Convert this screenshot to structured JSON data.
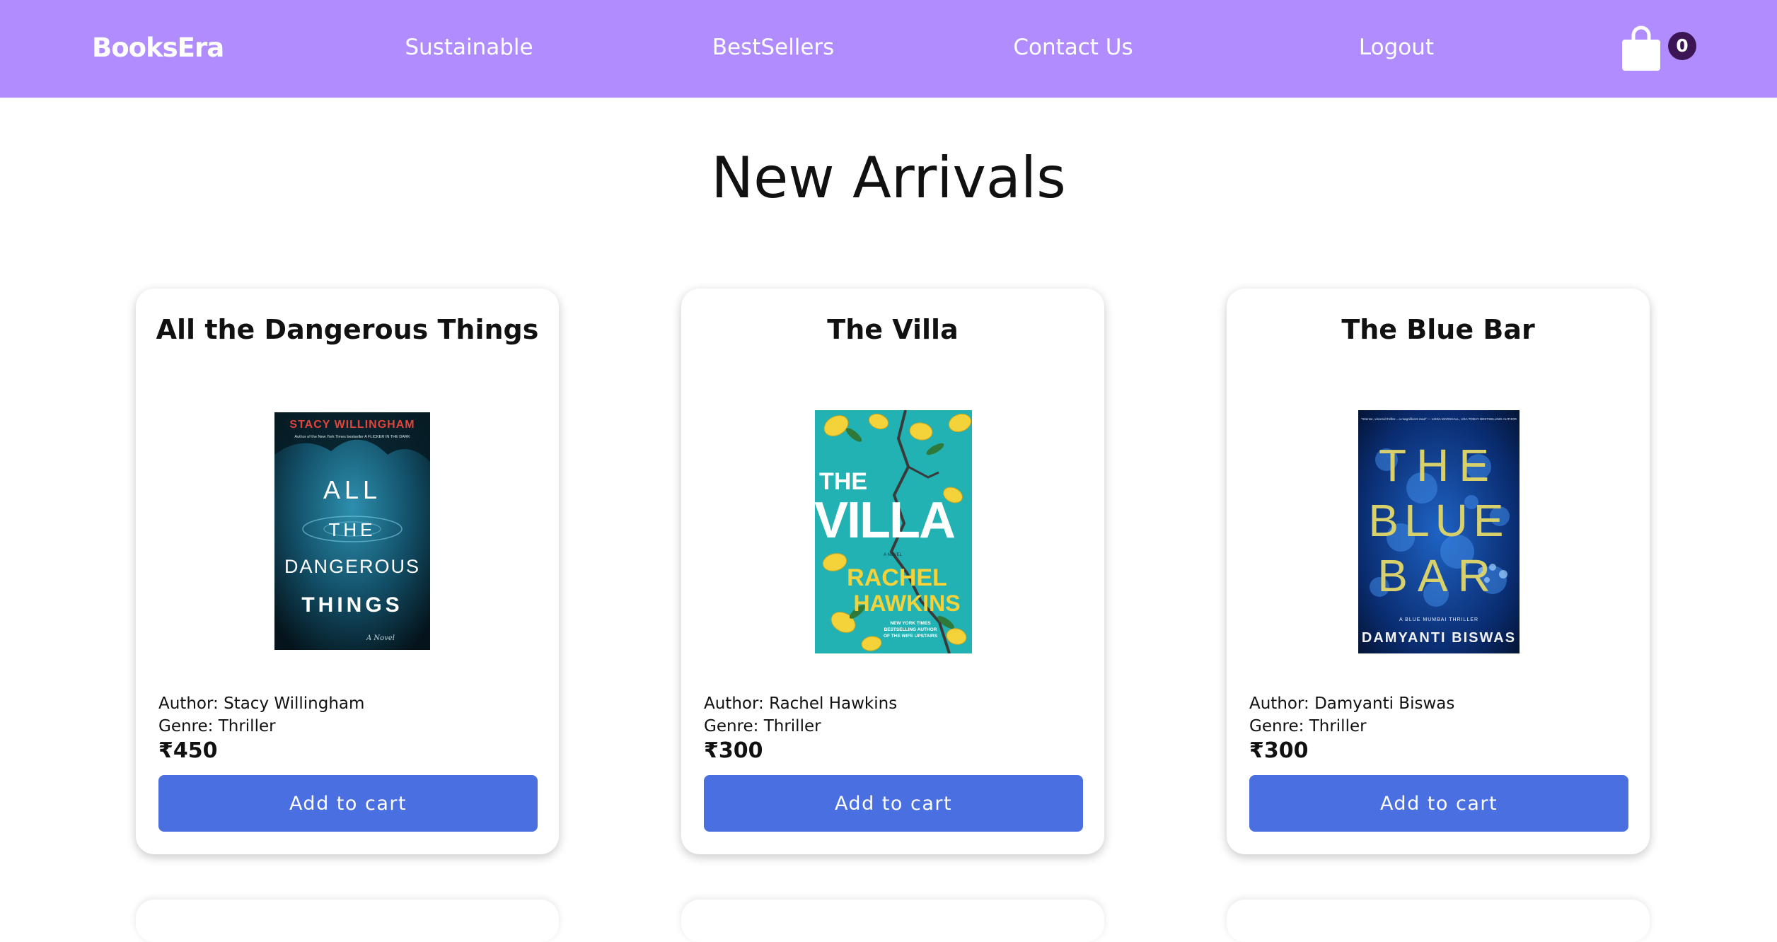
{
  "brand": "BooksEra",
  "nav": {
    "links": [
      "Sustainable",
      "BestSellers",
      "Contact Us",
      "Logout"
    ],
    "cart_count": "0"
  },
  "page_title": "New Arrivals",
  "books": [
    {
      "title": "All the Dangerous Things",
      "author": "Author: Stacy Willingham",
      "genre": "Genre: Thriller",
      "price": "₹450",
      "button": "Add to cart",
      "cover": {
        "top_text": "STACY WILLINGHAM",
        "subtitle": "Author of the New York Times bestseller A FLICKER IN THE DARK",
        "lines": [
          "ALL",
          "THE",
          "DANGEROUS",
          "THINGS"
        ],
        "footer": "A Novel"
      }
    },
    {
      "title": "The Villa",
      "author": "Author: Rachel Hawkins",
      "genre": "Genre: Thriller",
      "price": "₹300",
      "button": "Add to cart",
      "cover": {
        "lines": [
          "THE",
          "VILLA"
        ],
        "small": "A NOVEL",
        "author_lines": [
          "RACHEL",
          "HAWKINS"
        ],
        "blurb": [
          "NEW YORK TIMES",
          "BESTSELLING AUTHOR",
          "OF THE WIFE UPSTAIRS"
        ]
      }
    },
    {
      "title": "The Blue Bar",
      "author": "Author: Damyanti Biswas",
      "genre": "Genre: Thriller",
      "price": "₹300",
      "button": "Add to cart",
      "cover": {
        "blurb": "“Intense, visceral thriller... a magnificent read” — LISSA MARSHALL, USA TODAY BESTSELLING AUTHOR",
        "lines": [
          "THE",
          "BLUE",
          "BAR"
        ],
        "small": "A BLUE MUMBAI THRILLER",
        "author": "DAMYANTI BISWAS"
      }
    }
  ],
  "colors": {
    "navbar": "#b08cff",
    "button": "#4a6fe0",
    "badge": "#3b1554",
    "cover1": "#0e3d4f",
    "cover2": "#22b2b4",
    "cover3": "#0a2c70"
  },
  "icons": {
    "cart": "shopping-bag-icon"
  }
}
